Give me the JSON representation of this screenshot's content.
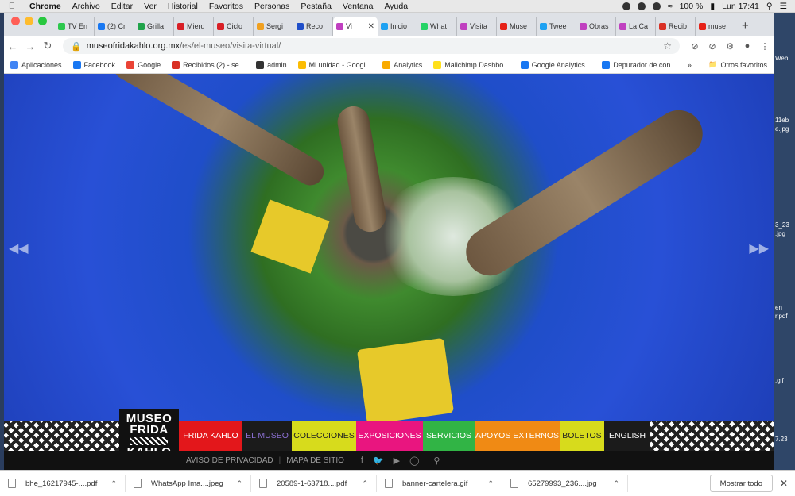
{
  "menubar": {
    "app": "Chrome",
    "menus": [
      "Archivo",
      "Editar",
      "Ver",
      "Historial",
      "Favoritos",
      "Personas",
      "Pestaña",
      "Ventana",
      "Ayuda"
    ],
    "battery": "100 %",
    "clock": "Lun 17:41"
  },
  "tabs": [
    {
      "label": "TV En",
      "color": "#2cc84d"
    },
    {
      "label": "(2) Cr",
      "color": "#1877f2"
    },
    {
      "label": "Grilla",
      "color": "#1fa34a"
    },
    {
      "label": "Mierd",
      "color": "#d81f26"
    },
    {
      "label": "Ciclo",
      "color": "#d81f26"
    },
    {
      "label": "Sergi",
      "color": "#f0a020"
    },
    {
      "label": "Reco",
      "color": "#1f4ec9"
    },
    {
      "label": "Vi",
      "color": "#c040c0",
      "active": true
    },
    {
      "label": "Inicio",
      "color": "#1da1f2"
    },
    {
      "label": "What",
      "color": "#25d366"
    },
    {
      "label": "Visita",
      "color": "#c040c0"
    },
    {
      "label": "Muse",
      "color": "#e62117"
    },
    {
      "label": "Twee",
      "color": "#1da1f2"
    },
    {
      "label": "Obras",
      "color": "#c040c0"
    },
    {
      "label": "La Ca",
      "color": "#c040c0"
    },
    {
      "label": "Recib",
      "color": "#d93025"
    },
    {
      "label": "muse",
      "color": "#e62117"
    }
  ],
  "address": {
    "host": "museofridakahlo.org.mx",
    "path": "/es/el-museo/visita-virtual/"
  },
  "bookmarks": [
    {
      "label": "Aplicaciones",
      "color": "#4285f4"
    },
    {
      "label": "Facebook",
      "color": "#1877f2"
    },
    {
      "label": "Google",
      "color": "#ea4335"
    },
    {
      "label": "Recibidos (2) - se...",
      "color": "#d93025"
    },
    {
      "label": "admin",
      "color": "#333333"
    },
    {
      "label": "Mi unidad - Googl...",
      "color": "#fbbc04"
    },
    {
      "label": "Analytics",
      "color": "#f9ab00"
    },
    {
      "label": "Mailchimp Dashbo...",
      "color": "#ffe01b"
    },
    {
      "label": "Google Analytics...",
      "color": "#1877f2"
    },
    {
      "label": "Depurador de con...",
      "color": "#1877f2"
    }
  ],
  "bookmarks_other": "Otros favoritos",
  "site": {
    "logo": [
      "MUSEO",
      "FRIDA",
      "KAHLO"
    ],
    "nav": [
      {
        "label": "FRIDA KAHLO",
        "bg": "#e3171b",
        "fg": "#ffffff",
        "w": 80
      },
      {
        "label": "EL MUSEO",
        "bg": "#1b1b1b",
        "fg": "#8a6fd1",
        "w": 62
      },
      {
        "label": "COLECCIONES",
        "bg": "#d7db1c",
        "fg": "#222222",
        "w": 81
      },
      {
        "label": "EXPOSICIONES",
        "bg": "#e9157f",
        "fg": "#ffffff",
        "w": 84
      },
      {
        "label": "SERVICIOS",
        "bg": "#31b445",
        "fg": "#ffffff",
        "w": 65
      },
      {
        "label": "APOYOS EXTERNOS",
        "bg": "#f08a14",
        "fg": "#ffffff",
        "w": 107
      },
      {
        "label": "BOLETOS",
        "bg": "#d7db1c",
        "fg": "#222222",
        "w": 56
      },
      {
        "label": "ENGLISH",
        "bg": "#1b1b1b",
        "fg": "#ffffff",
        "w": 58
      }
    ],
    "sub": [
      "AVISO DE PRIVACIDAD",
      "MAPA DE SITIO"
    ]
  },
  "desktop": [
    "Web",
    "11eb",
    "e.jpg",
    "3_23",
    ".jpg",
    "en",
    "r.pdf",
    ".gif",
    "7.23"
  ],
  "downloads": [
    "bhe_16217945-....pdf",
    "WhatsApp Ima....jpeg",
    "20589-1-63718....pdf",
    "banner-cartelera.gif",
    "65279993_236....jpg"
  ],
  "downloads_showall": "Mostrar todo"
}
